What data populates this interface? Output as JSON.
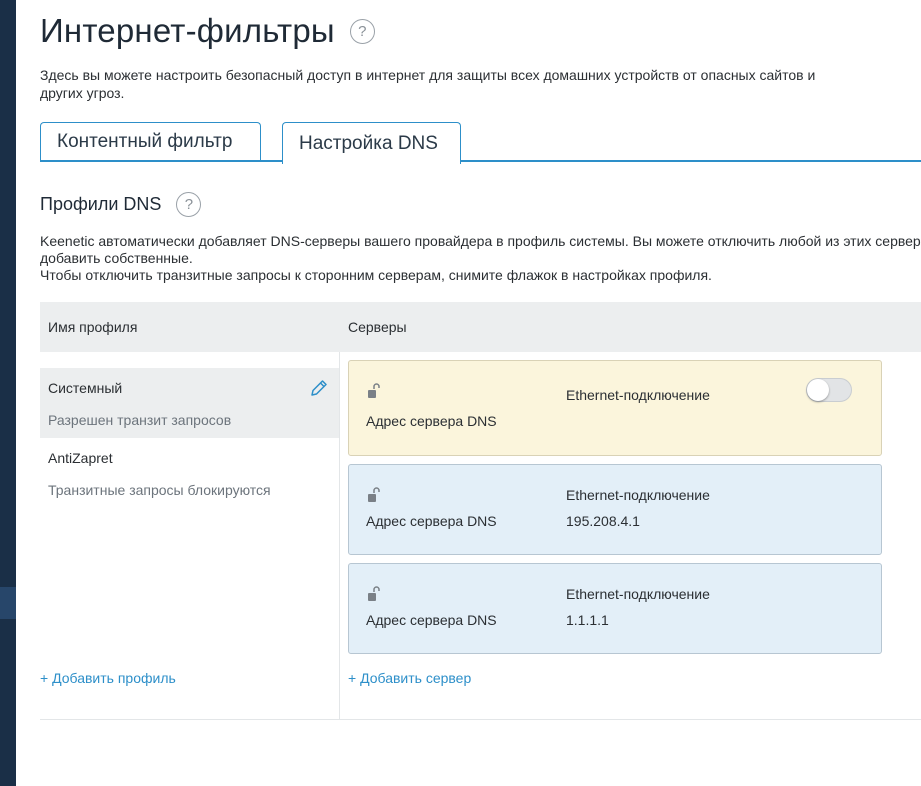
{
  "page": {
    "title": "Интернет-фильтры",
    "help_glyph": "?",
    "description": "Здесь вы можете настроить безопасный доступ в интернет для защиты всех домашних устройств от опасных сайтов и других угроз."
  },
  "tabs": [
    {
      "label": "Контентный фильтр",
      "active": false
    },
    {
      "label": "Настройка DNS",
      "active": true
    }
  ],
  "section": {
    "title": "Профили DNS",
    "help_glyph": "?",
    "desc_line1": "Keenetic автоматически добавляет DNS-серверы вашего провайдера в профиль системы. Вы можете отключить любой из этих серверов и",
    "desc_line2": "добавить собственные.",
    "desc_line3": "Чтобы отключить транзитные запросы к сторонним серверам, снимите флажок в настройках профиля."
  },
  "table": {
    "col_profile": "Имя профиля",
    "col_servers": "Серверы"
  },
  "profiles": [
    {
      "name": "Системный",
      "status": "Разрешен транзит запросов",
      "selected": true
    },
    {
      "name": "AntiZapret",
      "status": "Транзитные запросы блокируются",
      "selected": false
    }
  ],
  "servers": [
    {
      "connection": "Ethernet-подключение",
      "label": "Адрес сервера DNS",
      "address": "",
      "toggle_on": false
    },
    {
      "connection": "Ethernet-подключение",
      "label": "Адрес сервера DNS",
      "address": "195.208.4.1"
    },
    {
      "connection": "Ethernet-подключение",
      "label": "Адрес сервера DNS",
      "address": "1.1.1.1"
    }
  ],
  "actions": {
    "add_profile": "+ Добавить профиль",
    "add_server": "+ Добавить сервер"
  },
  "colors": {
    "accent": "#2d8fc9",
    "sidebar": "#1a2f47",
    "card_yellow": "#fbf5dc",
    "card_blue": "#e3eff8"
  }
}
